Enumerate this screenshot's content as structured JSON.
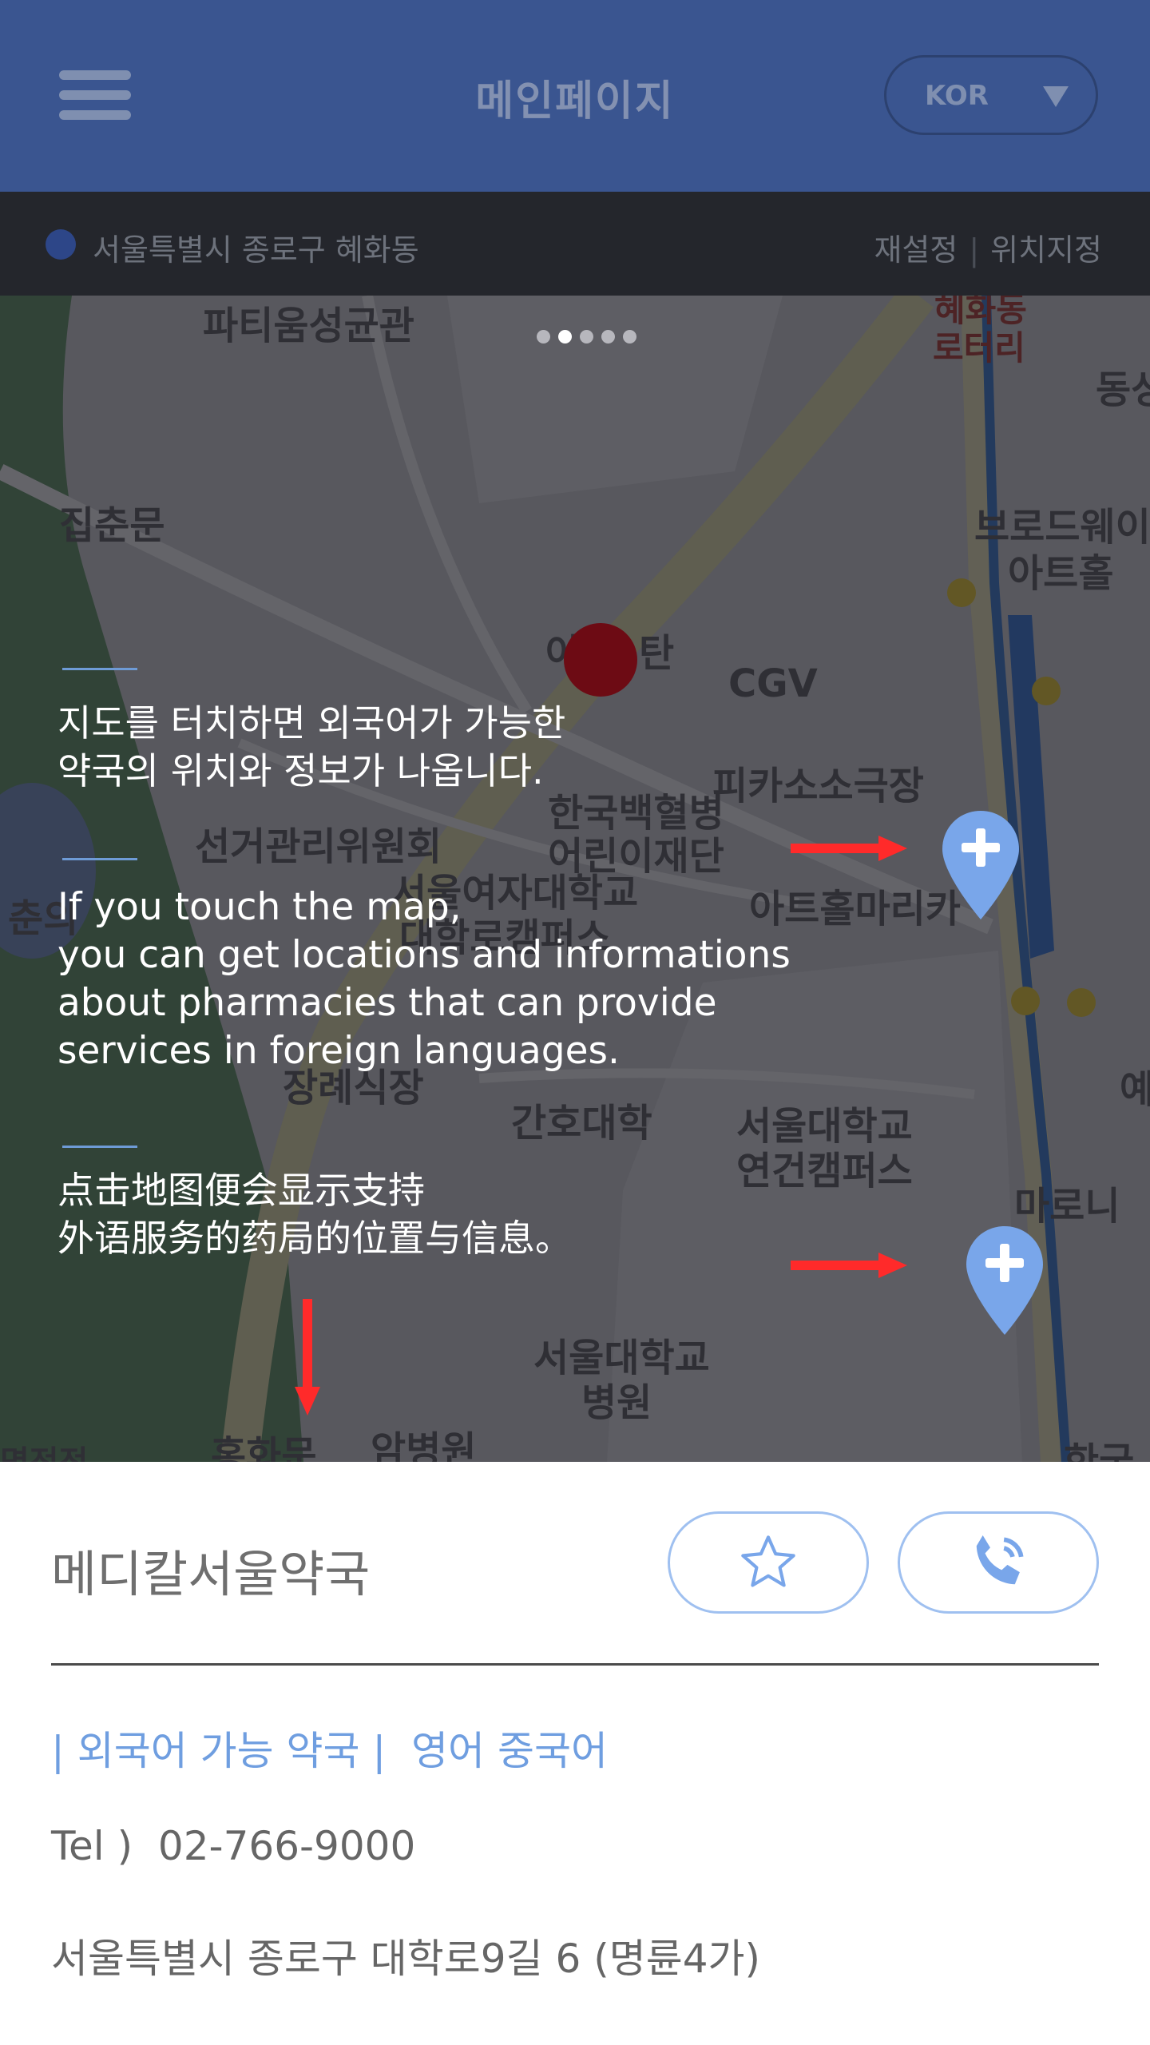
{
  "header": {
    "title": "메인페이지",
    "language": "KOR"
  },
  "location": {
    "address": "서울특별시 종로구 혜화동",
    "reset_label": "재설정",
    "separator": "|",
    "set_label": "위치지정"
  },
  "map": {
    "labels": [
      "파티움성균관",
      "혜화동",
      "로터리",
      "동성",
      "집춘문",
      "브로드웨이",
      "아트홀",
      "이",
      "탄",
      "CGV",
      "피카소소극장",
      "한국백혈병",
      "어린이재단",
      "선거관리위원회",
      "서울여자대학교",
      "대학로캠퍼스",
      "아트홀마리카",
      "춘의",
      "장례식장",
      "간호대학",
      "서울대학교",
      "연건캠퍼스",
      "마로니",
      "서울대학교",
      "병원",
      "홍화문",
      "암병원",
      "명전전",
      "한국",
      "예"
    ],
    "carousel_active_index": 1,
    "carousel_count": 5
  },
  "guide": {
    "korean": "지도를 터치하면 외국어가 가능한\n약국의 위치와 정보가 나옵니다.",
    "english": "If you touch the map,\nyou can get locations and informations\nabout pharmacies that can provide\nservices in foreign languages.",
    "chinese": "点击地图便会显示支持\n外语服务的药局的位置与信息。"
  },
  "pharmacy": {
    "name": "메디칼서울약국",
    "lang_prefix": "| 외국어 가능 약국 |",
    "languages": "영어 중국어",
    "tel_label": "Tel )",
    "tel": "02-766-9000",
    "address": "서울특별시 종로구 대학로9길 6 (명륜4가)"
  },
  "colors": {
    "header_bg": "#3a5590",
    "location_bar_bg": "#24262c",
    "accent_blue": "#6f9ee0",
    "pin_blue": "#79a6ea",
    "arrow_red": "#ff2a2a"
  }
}
